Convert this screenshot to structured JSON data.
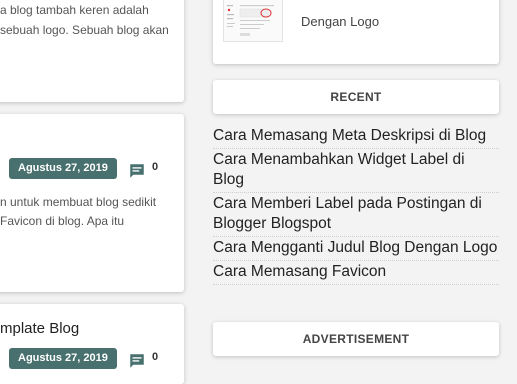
{
  "posts": [
    {
      "excerpt_lines": [
        "a blog tambah keren adalah",
        "sebuah logo. Sebuah blog akan"
      ]
    },
    {
      "date": "Agustus 27, 2019",
      "comments": "0",
      "excerpt_lines": [
        "n untuk membuat blog sedikit",
        "Favicon di blog. Apa itu"
      ]
    },
    {
      "title": "mplate Blog",
      "date": "Agustus 27, 2019",
      "comments": "0"
    }
  ],
  "sidebar": {
    "featured_title": "Dengan Logo",
    "recent_header": "RECENT",
    "recent": [
      {
        "label": "Cara Memasang Meta Deskripsi di Blog"
      },
      {
        "label": "Cara Menambahkan Widget Label di Blog"
      },
      {
        "label": "Cara Memberi Label pada Postingan di Blogger Blogspot"
      },
      {
        "label": "Cara Mengganti Judul Blog Dengan Logo"
      },
      {
        "label": "Cara Memasang Favicon"
      }
    ],
    "ads_header": "ADVERTISEMENT"
  },
  "icons": {
    "comments": "comment-icon"
  },
  "colors": {
    "badge": "#47706e",
    "background": "#f3f3f3"
  }
}
